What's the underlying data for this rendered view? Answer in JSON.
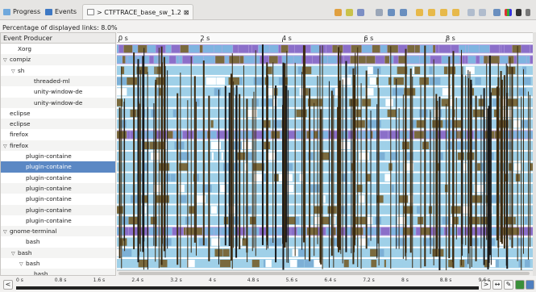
{
  "tabs": [
    {
      "label": "Progress",
      "icon": "progress-icon"
    },
    {
      "label": "Events",
      "icon": "events-icon"
    },
    {
      "label": "> CTFTRACE_base_sw_1.2",
      "icon": "control-flow-icon",
      "close": "⊠"
    }
  ],
  "toolbar_icons": [
    "legend-icon",
    "filter-icon",
    "remove-filter-icon",
    "reset-icon",
    "zoom-in-icon",
    "zoom-out-icon",
    "prev-event-icon",
    "next-event-icon",
    "prev-item-icon",
    "next-item-icon",
    "arrows-icon",
    "collapse-icon",
    "expand-icon",
    "color-icon",
    "stats-icon",
    "view-menu-icon",
    "pin-icon"
  ],
  "percentage_text": "Percentage of displayed links: 8.0%",
  "tree": {
    "header": "Event Producer",
    "rows": [
      {
        "label": "Xorg",
        "indent": 1,
        "toggle": ""
      },
      {
        "label": "compiz",
        "indent": 0,
        "toggle": "▽"
      },
      {
        "label": "sh",
        "indent": 1,
        "toggle": "▽"
      },
      {
        "label": "threaded-ml",
        "indent": 3,
        "toggle": ""
      },
      {
        "label": "unity-window-de",
        "indent": 3,
        "toggle": ""
      },
      {
        "label": "unity-window-de",
        "indent": 3,
        "toggle": ""
      },
      {
        "label": "eclipse",
        "indent": 0,
        "toggle": ""
      },
      {
        "label": "eclipse",
        "indent": 0,
        "toggle": ""
      },
      {
        "label": "firefox",
        "indent": 0,
        "toggle": ""
      },
      {
        "label": "firefox",
        "indent": 0,
        "toggle": "▽"
      },
      {
        "label": "plugin-containe",
        "indent": 2,
        "toggle": ""
      },
      {
        "label": "plugin-containe",
        "indent": 2,
        "toggle": "",
        "selected": true
      },
      {
        "label": "plugin-containe",
        "indent": 2,
        "toggle": ""
      },
      {
        "label": "plugin-containe",
        "indent": 2,
        "toggle": ""
      },
      {
        "label": "plugin-containe",
        "indent": 2,
        "toggle": ""
      },
      {
        "label": "plugin-containe",
        "indent": 2,
        "toggle": ""
      },
      {
        "label": "plugin-containe",
        "indent": 2,
        "toggle": ""
      },
      {
        "label": "gnome-terminal",
        "indent": 0,
        "toggle": "▽"
      },
      {
        "label": "bash",
        "indent": 2,
        "toggle": ""
      },
      {
        "label": "bash",
        "indent": 1,
        "toggle": "▽"
      },
      {
        "label": "bash",
        "indent": 2,
        "toggle": "▽"
      },
      {
        "label": "bash",
        "indent": 3,
        "toggle": ""
      }
    ]
  },
  "time_axis": {
    "labels": [
      "0 s",
      "2 s",
      "4 s",
      "6 s",
      "8 s"
    ]
  },
  "ruler": {
    "left_button": "<",
    "right_button": ">",
    "labels": [
      "0 s",
      "0.8 s",
      "1.6 s",
      "2.4 s",
      "3.2 s",
      "4 s",
      "4.8 s",
      "5.6 s",
      "6.4 s",
      "7.2 s",
      "8 s",
      "8.8 s",
      "9.6 s"
    ],
    "extra_buttons": [
      "fit-icon",
      "pencil-icon",
      "sync-icon",
      "settings-icon"
    ]
  },
  "colors": {
    "running": "#9fd0e8",
    "wait_blocked": "#7a6a3e",
    "syscall": "#8b6fc9",
    "selection": "#5b88c4",
    "link": "#1a1a1a"
  }
}
